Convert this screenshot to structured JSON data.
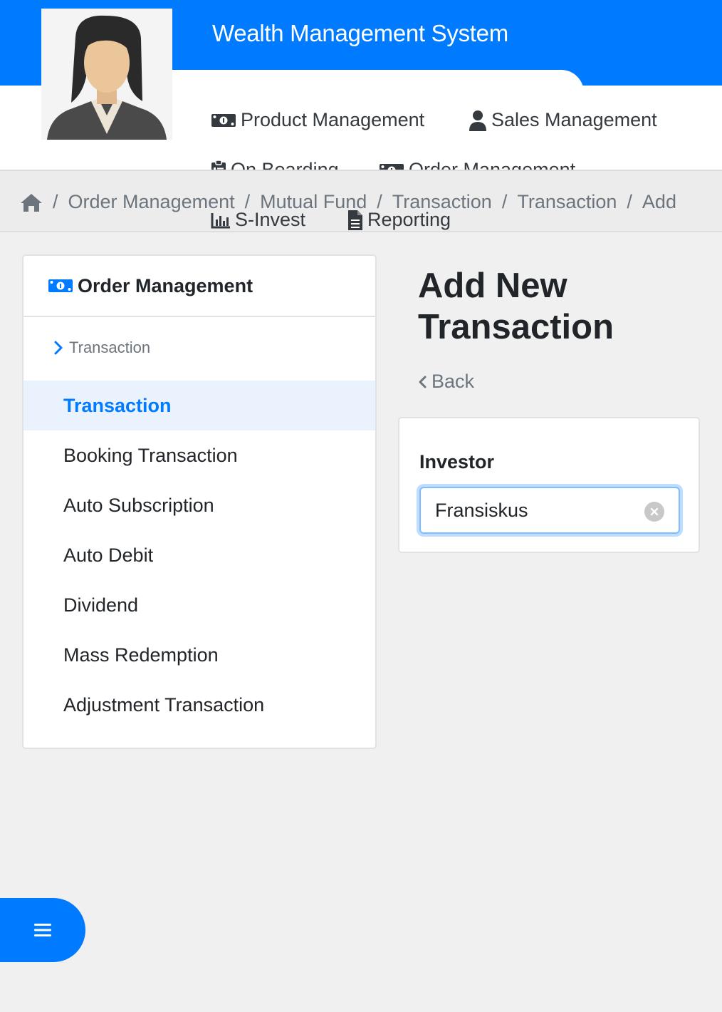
{
  "header": {
    "app_title": "Wealth Management System",
    "accent_color": "#007bff",
    "avatar_icon": "user-avatar-female"
  },
  "nav": {
    "items": [
      {
        "label": "Product Management",
        "icon": "money-bill-icon"
      },
      {
        "label": "Sales Management",
        "icon": "user-icon"
      },
      {
        "label": "On Boarding",
        "icon": "clipboard-list-icon"
      },
      {
        "label": "Order Management",
        "icon": "money-bill-icon"
      },
      {
        "label": "S-Invest",
        "icon": "chart-bar-icon"
      },
      {
        "label": "Reporting",
        "icon": "file-icon"
      }
    ]
  },
  "breadcrumb": {
    "home_icon": "home-icon",
    "separator": "/",
    "items": [
      "Order Management",
      "Mutual Fund",
      "Transaction",
      "Transaction",
      "Add"
    ]
  },
  "sidebar": {
    "title": "Order Management",
    "sub_label": "Transaction",
    "items": [
      {
        "label": "Transaction",
        "active": true
      },
      {
        "label": "Booking Transaction",
        "active": false
      },
      {
        "label": "Auto Subscription",
        "active": false
      },
      {
        "label": "Auto Debit",
        "active": false
      },
      {
        "label": "Dividend",
        "active": false
      },
      {
        "label": "Mass Redemption",
        "active": false
      },
      {
        "label": "Adjustment Transaction",
        "active": false
      }
    ]
  },
  "main": {
    "title": "Add New Transaction",
    "back_label": "Back",
    "form": {
      "investor_label": "Investor",
      "investor_value": "Fransiskus"
    }
  },
  "fab": {
    "icon": "menu-icon"
  }
}
